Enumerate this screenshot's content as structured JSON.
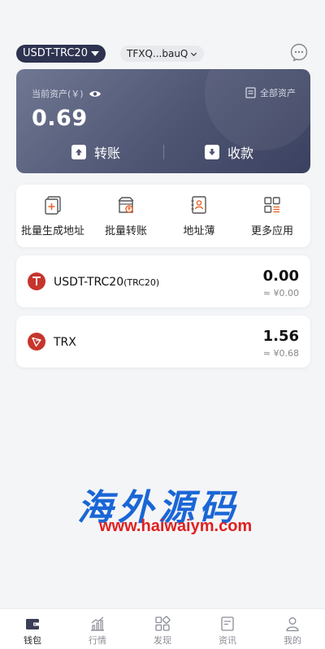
{
  "header": {
    "chain": "USDT-TRC20",
    "address": "TFXQ...bauQ"
  },
  "asset_card": {
    "label": "当前资产(￥)",
    "all_assets": "全部资产",
    "amount": "0.69",
    "transfer": "转账",
    "receive": "收款"
  },
  "apps": [
    {
      "label": "批量生成地址"
    },
    {
      "label": "批量转账"
    },
    {
      "label": "地址薄"
    },
    {
      "label": "更多应用"
    }
  ],
  "tokens": [
    {
      "name": "USDT-TRC20",
      "sub": "(TRC20)",
      "balance": "0.00",
      "fiat": "≈ ¥0.00"
    },
    {
      "name": "TRX",
      "sub": "",
      "balance": "1.56",
      "fiat": "≈ ¥0.68"
    }
  ],
  "watermark": {
    "title": "海外源码",
    "url": "www.haiwaiym.com"
  },
  "tabbar": [
    {
      "label": "钱包",
      "icon": "wallet-icon",
      "active": true
    },
    {
      "label": "行情",
      "icon": "chart-icon",
      "active": false
    },
    {
      "label": "发现",
      "icon": "discover-icon",
      "active": false
    },
    {
      "label": "资讯",
      "icon": "news-icon",
      "active": false
    },
    {
      "label": "我的",
      "icon": "profile-icon",
      "active": false
    }
  ],
  "colors": {
    "card_dark": "#3b4160",
    "pill_dark": "#2e3350",
    "tron_red": "#c6352c",
    "accent_orange": "#e8662a",
    "watermark_blue": "#1a66d6",
    "watermark_red": "#e02020"
  }
}
